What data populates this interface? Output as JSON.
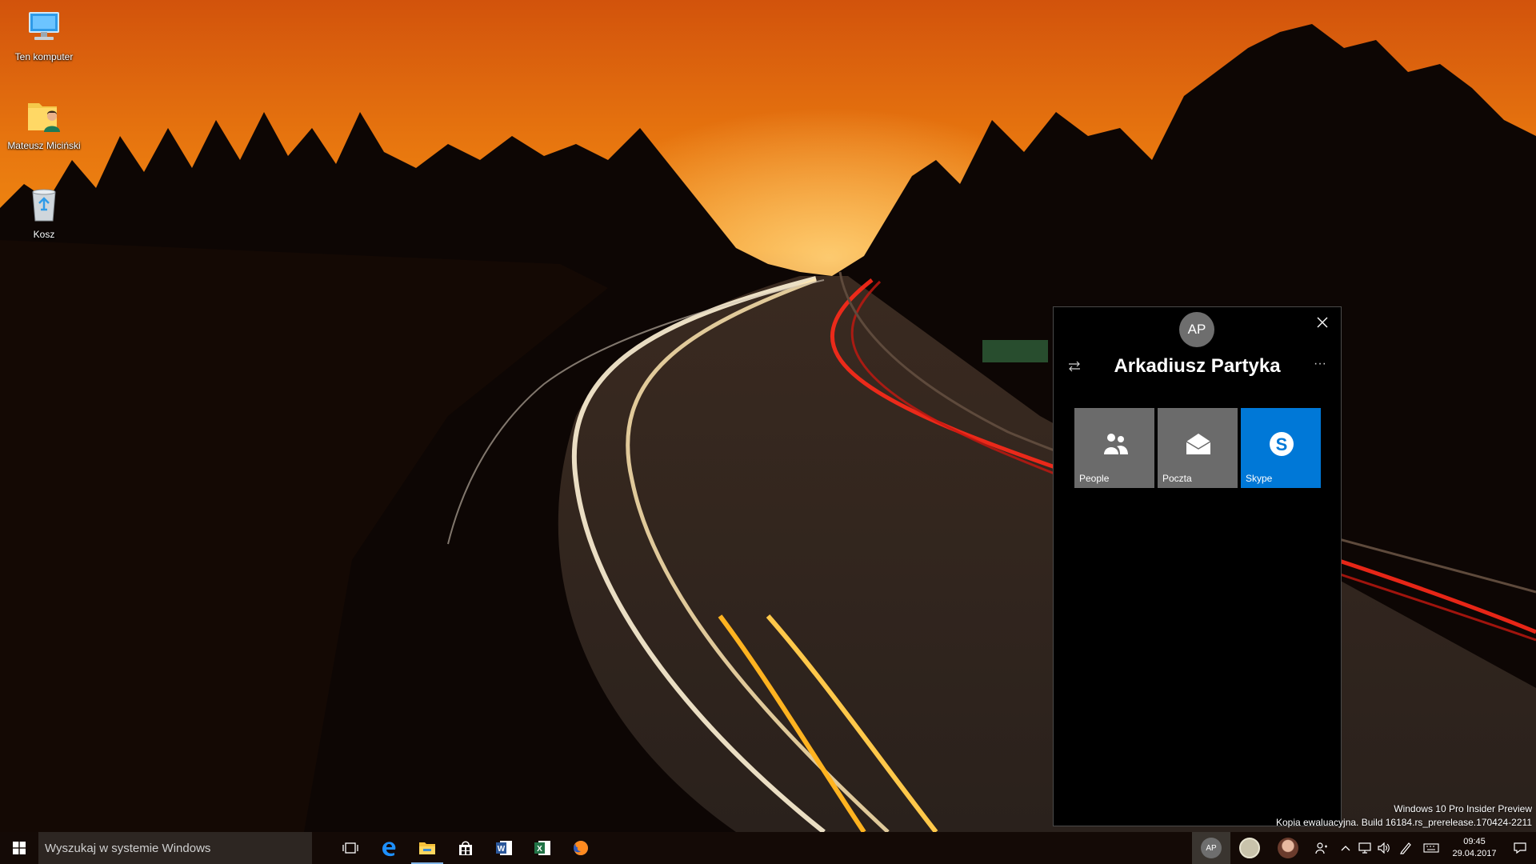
{
  "desktop": {
    "icons": [
      {
        "label": "Ten komputer",
        "icon": "computer-icon"
      },
      {
        "label": "Mateusz Miciński",
        "icon": "user-folder-icon"
      },
      {
        "label": "Kosz",
        "icon": "recycle-bin-icon"
      }
    ]
  },
  "people_flyout": {
    "avatar_initials": "AP",
    "contact_name": "Arkadiusz Partyka",
    "close_icon": "close-icon",
    "swap_icon": "swap-icon",
    "more_icon": "more-icon",
    "more_glyph": "···",
    "apps": [
      {
        "label": "People",
        "icon": "people-icon",
        "color": "#6b6b6b"
      },
      {
        "label": "Poczta",
        "icon": "mail-icon",
        "color": "#6b6b6b"
      },
      {
        "label": "Skype",
        "icon": "skype-icon",
        "color": "#0078d7"
      }
    ]
  },
  "watermark": {
    "line1": "Windows 10 Pro Insider Preview",
    "line2": "Kopia ewaluacyjna. Build 16184.rs_prerelease.170424-2211"
  },
  "taskbar": {
    "search_placeholder": "Wyszukaj w systemie Windows",
    "pinned_apps": [
      "task-view-icon",
      "edge-icon",
      "file-explorer-icon",
      "store-icon",
      "word-icon",
      "excel-icon",
      "firefox-icon"
    ],
    "people_pins": [
      {
        "initials": "AP",
        "icon": "contact-avatar-icon"
      },
      {
        "initials": "",
        "icon": "contact-avatar-icon"
      },
      {
        "initials": "",
        "icon": "contact-photo-icon"
      }
    ],
    "tray": [
      "people-icon",
      "chevron-up-icon",
      "network-icon",
      "volume-icon",
      "pen-icon",
      "keyboard-icon"
    ],
    "clock_time": "09:45",
    "clock_date": "29.04.2017"
  },
  "colors": {
    "accent": "#0078d7",
    "tile_gray": "#6b6b6b",
    "flyout_bg": "#000000"
  }
}
